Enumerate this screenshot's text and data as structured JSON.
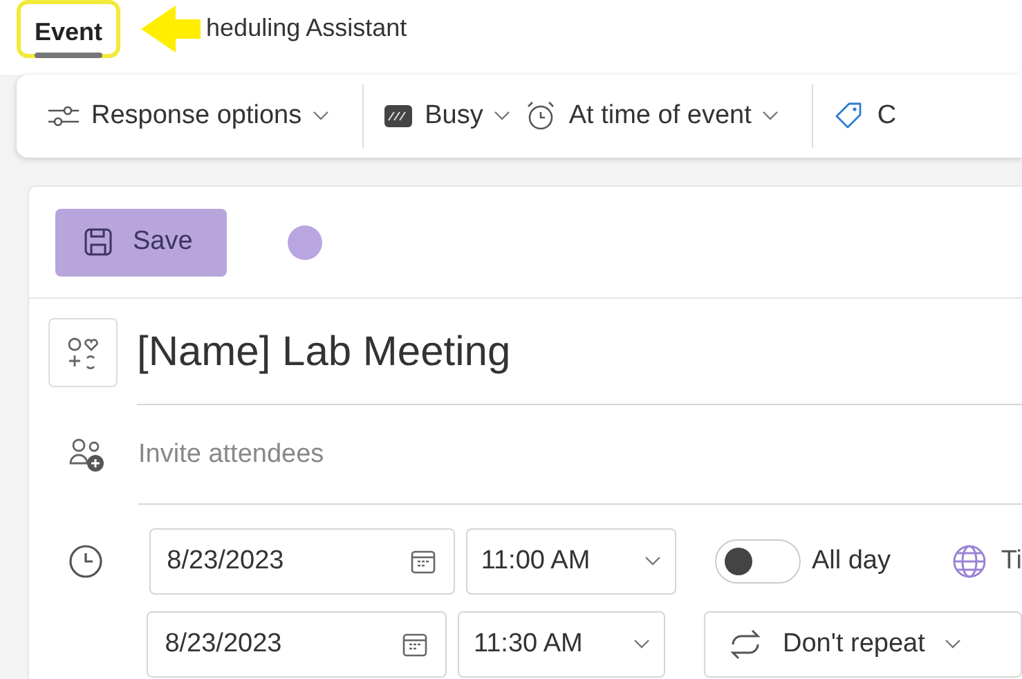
{
  "tabs": [
    {
      "label": "Event",
      "selected": true,
      "highlighted": true
    },
    {
      "label": "heduling Assistant",
      "selected": false,
      "highlighted": false
    }
  ],
  "toolbar": [
    {
      "label": "Response options",
      "kind": "sliders"
    },
    {
      "label": "Busy",
      "kind": "status"
    },
    {
      "label": "At time of event",
      "kind": "alarm"
    },
    {
      "label": "C",
      "kind": "tag"
    }
  ],
  "save_button": {
    "label": "Save",
    "disabled": true
  },
  "title": "[Name] Lab Meeting",
  "attendees": {
    "placeholder": "Invite attendees"
  },
  "start": {
    "date": "8/23/2023",
    "time": "11:00 AM"
  },
  "all_day": {
    "label": "All day",
    "on": false
  },
  "time_zones": {
    "label": "Ti"
  },
  "end": {
    "date": "8/23/2023",
    "time": "11:30 AM"
  },
  "repeat": {
    "label": "Don't repeat"
  }
}
